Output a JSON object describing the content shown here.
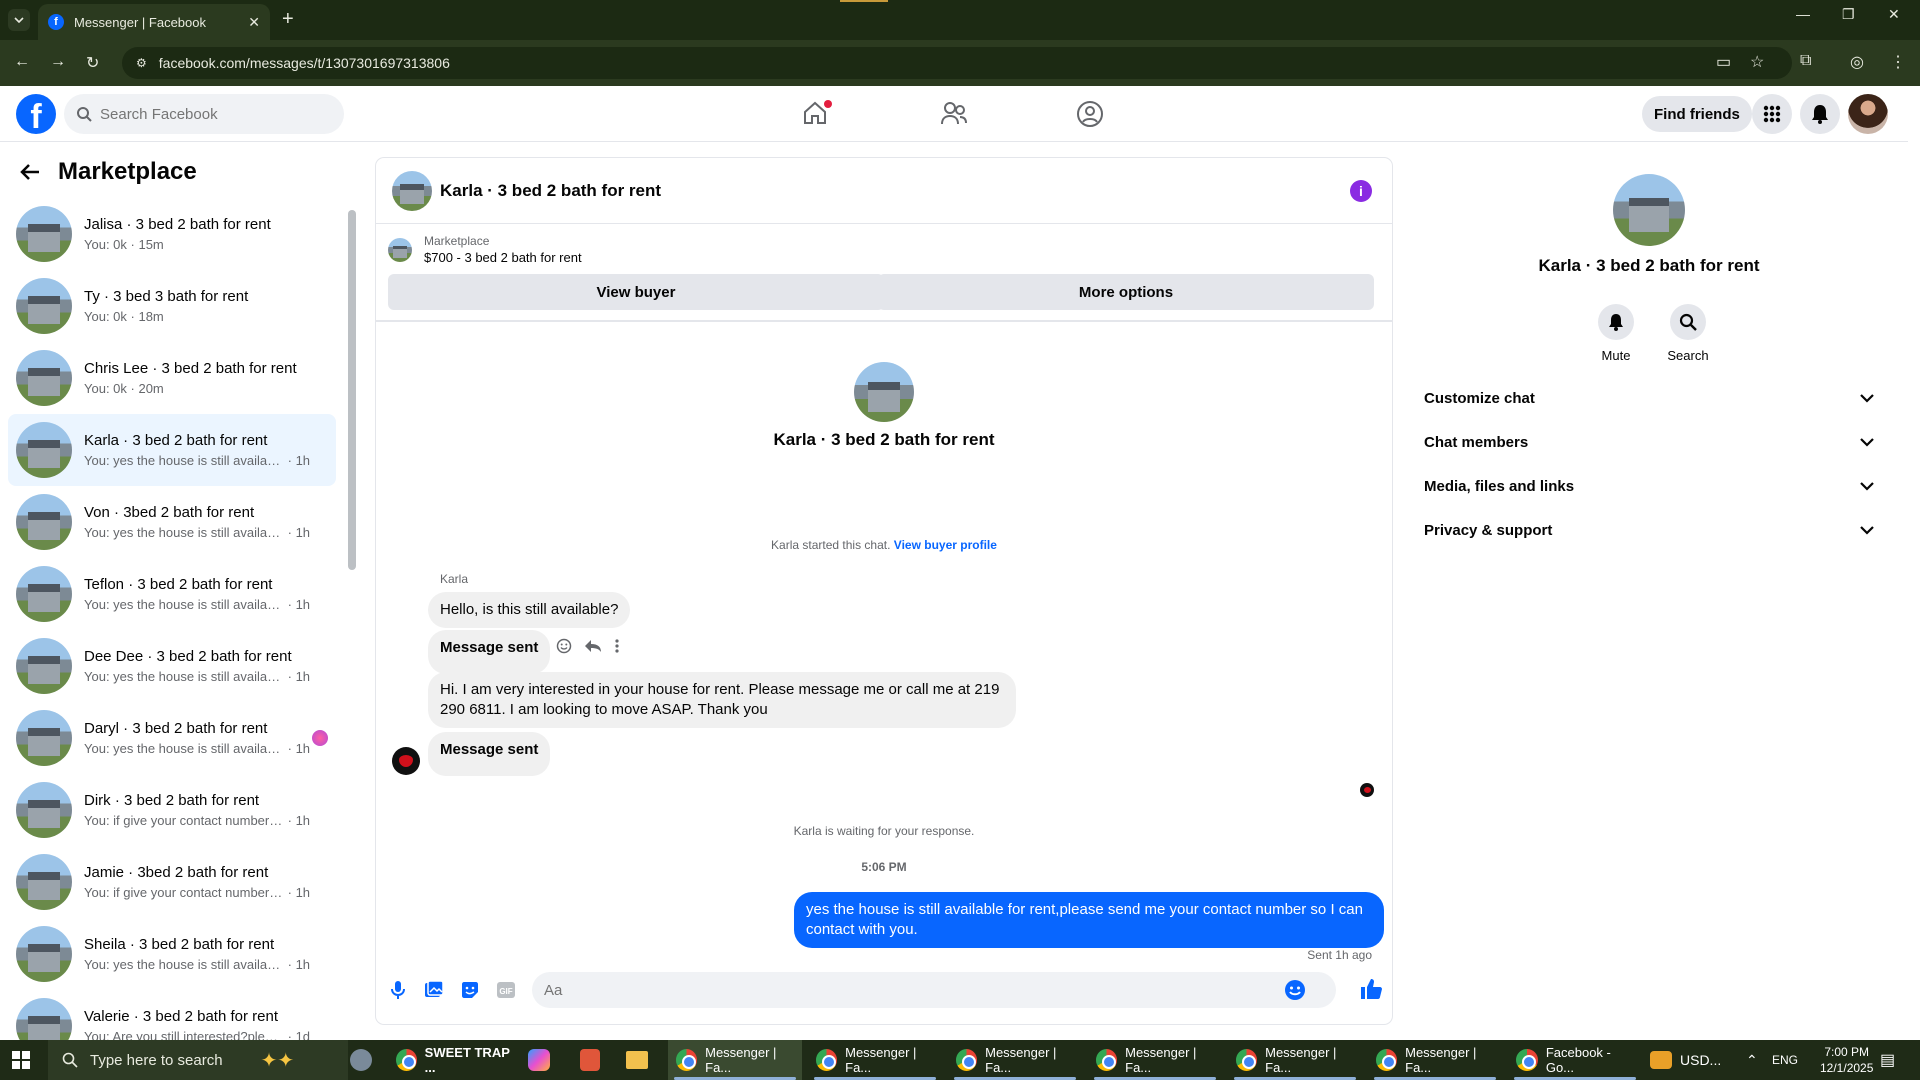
{
  "browser": {
    "tab_title": "Messenger | Facebook",
    "url": "facebook.com/messages/t/1307301697313806"
  },
  "header": {
    "search_placeholder": "Search Facebook",
    "find_friends": "Find friends"
  },
  "sidebar": {
    "title": "Marketplace",
    "conversations": [
      {
        "name": "Jalisa · 3 bed 2 bath for rent",
        "preview": "You: 0k",
        "time": "· 15m"
      },
      {
        "name": "Ty · 3 bed 3 bath for rent",
        "preview": "You: 0k",
        "time": "· 18m"
      },
      {
        "name": "Chris Lee · 3 bed 2 bath for rent",
        "preview": "You: 0k",
        "time": "· 20m"
      },
      {
        "name": "Karla · 3 bed 2 bath for rent",
        "preview": "You: yes the house is still available f...",
        "time": "· 1h"
      },
      {
        "name": "Von · 3bed 2 bath for rent",
        "preview": "You: yes the house is still available f...",
        "time": "· 1h"
      },
      {
        "name": "Teflon · 3 bed 2 bath for rent",
        "preview": "You: yes the house is still available f...",
        "time": "· 1h"
      },
      {
        "name": "Dee Dee · 3 bed 2 bath for rent",
        "preview": "You: yes the house is still available f...",
        "time": "· 1h"
      },
      {
        "name": "Daryl · 3 bed 2 bath for rent",
        "preview": "You: yes the house is still availab...",
        "time": "· 1h"
      },
      {
        "name": "Dirk · 3 bed 2 bath for rent",
        "preview": "You: if give your contact number se...",
        "time": "· 1h"
      },
      {
        "name": "Jamie · 3bed 2 bath for rent",
        "preview": "You: if give your contact number se...",
        "time": "· 1h"
      },
      {
        "name": "Sheila · 3 bed 2 bath for rent",
        "preview": "You: yes the house is still available f...",
        "time": "· 1h"
      },
      {
        "name": "Valerie · 3 bed 2 bath for rent",
        "preview": "You: Are you still interested?please ...",
        "time": "· 1d"
      }
    ]
  },
  "chat": {
    "title": "Karla · 3 bed 2 bath for rent",
    "marketplace_label": "Marketplace",
    "listing": "$700 - 3 bed 2 bath for rent",
    "view_buyer": "View buyer",
    "more_options": "More options",
    "intro_name": "Karla · 3 bed 2 bath for rent",
    "started_text": "Karla started this chat.",
    "view_buyer_profile": "View buyer profile",
    "sender_name": "Karla",
    "messages": [
      "Hello, is this still available?",
      "Message sent",
      "Hi. I am very interested in your house for rent. Please message me or call me at 219 290 6811. I am looking to move ASAP. Thank you",
      "Message sent"
    ],
    "waiting_text": "Karla is waiting for your response.",
    "timestamp": "5:06 PM",
    "my_message": "yes the house is still available for rent,please send me your contact number so I can contact with you.",
    "sent_status": "Sent 1h ago",
    "input_placeholder": "Aa"
  },
  "details": {
    "name": "Karla · 3 bed 2 bath for rent",
    "mute": "Mute",
    "search": "Search",
    "sections": [
      "Customize chat",
      "Chat members",
      "Media, files and links",
      "Privacy & support"
    ]
  },
  "taskbar": {
    "search_placeholder": "Type here to search",
    "apps": [
      "SWEET TRAP ...",
      "Messenger | Fa...",
      "Messenger | Fa...",
      "Messenger | Fa...",
      "Messenger | Fa...",
      "Messenger | Fa...",
      "Messenger | Fa...",
      "Facebook - Go..."
    ],
    "currency": "USD...",
    "lang": "ENG",
    "time": "7:00 PM",
    "date": "12/1/2025"
  }
}
